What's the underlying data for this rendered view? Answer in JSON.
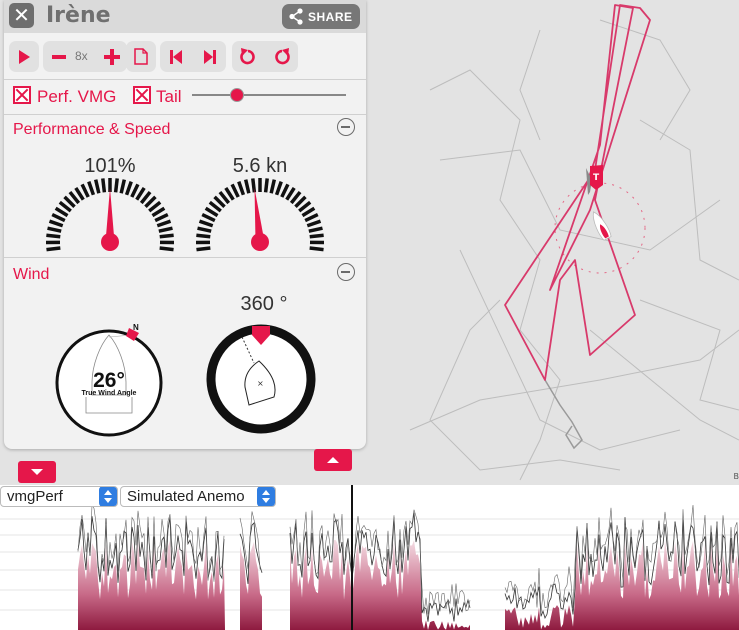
{
  "boat": {
    "name": "Irène"
  },
  "header": {
    "share_label": "SHARE"
  },
  "toolbar": {
    "speed_label": "8x"
  },
  "options": {
    "perf_vmg_label": "Perf. VMG",
    "tail_label": "Tail",
    "tail_checked": true,
    "perf_vmg_checked": true,
    "tail_slider_fraction": 0.27
  },
  "performance": {
    "title": "Performance & Speed",
    "vmg_perf_text": "101%",
    "vmg_perf_fraction": 0.5,
    "speed_text": "5.6 kn",
    "speed_fraction": 0.47
  },
  "wind": {
    "title": "Wind",
    "north_label": "N",
    "twa_value": "26°",
    "twa_label": "True Wind Angle",
    "heading_value": "360 °"
  },
  "chart": {
    "metric_select": "vmgPerf",
    "source_select": "Simulated Anemo"
  },
  "colors": {
    "accent": "#e5174a",
    "track": "#d83a6b",
    "ghost_track": "#b7b7b7",
    "panel": "#f2f2f2"
  },
  "icons": {
    "close": "close-icon",
    "share": "share-icon",
    "play": "play-icon",
    "minus": "minus-icon",
    "plus": "plus-icon",
    "page": "page-icon",
    "skip_back": "skip-back-icon",
    "skip_forward": "skip-forward-icon",
    "rotate_left": "rotate-left-icon",
    "rotate_right": "rotate-right-icon"
  }
}
